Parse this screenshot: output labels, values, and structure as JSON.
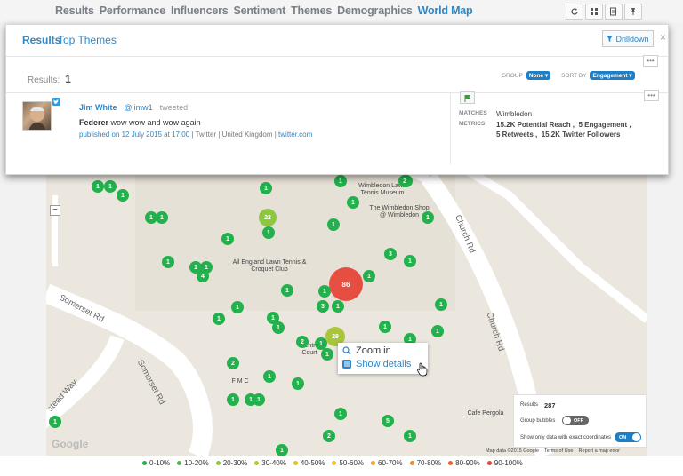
{
  "nav": {
    "tabs": [
      "Results",
      "Performance",
      "Influencers",
      "Sentiment",
      "Themes",
      "Demographics",
      "World Map"
    ],
    "active_tab": "World Map",
    "tools": [
      "refresh-icon",
      "grid-icon",
      "export-icon",
      "pin-icon"
    ]
  },
  "panel": {
    "title": "Results",
    "secondary_title": "Top Themes",
    "drilldown_label": "Drilldown",
    "close_label": "×",
    "results_label": "Results:",
    "results_count": "1",
    "group_label": "GROUP",
    "group_value": "None",
    "sort_label": "SORT BY",
    "sort_value": "Engagement",
    "tweet": {
      "author": "Jim White",
      "handle": "@jimw1",
      "verb": "tweeted",
      "keyword": "Federer",
      "text": " wow wow and wow again",
      "published_prefix": "published on 12 July 2015 at 17:00",
      "sep1": " | ",
      "platform": "Twitter",
      "sep2": " | ",
      "location": "United Kingdom",
      "sep3": " | ",
      "link": "twitter.com"
    },
    "meta": {
      "matches_label": "MATCHES",
      "matches_value": "Wimbledon",
      "metrics_label": "METRICS",
      "metrics_line1": "15.2K Potential Reach ,  5 Engagement ,",
      "metrics_line2": "5 Retweets ,  15.2K Twitter Followers"
    }
  },
  "map": {
    "labels": {
      "museum": "Wimbledon Lawn Tennis Museum",
      "shop": "The Wimbledon Shop @ Wimbledon",
      "club": "All England Lawn Tennis & Croquet Club",
      "centre": "Centre Court",
      "fmc": "F M C",
      "pergola": "Cafe Pergola",
      "somerset1": "Somerset Rd",
      "somerset2": "Somerset Rd",
      "church1": "Church Rd",
      "church2": "Church Rd",
      "way": "stead Way",
      "google": "Google",
      "attribution": "Map data ©2015 Google    Terms of Use    Report a map error"
    },
    "zoom_out": "−",
    "context_menu": {
      "zoom_in": "Zoom in",
      "show_details": "Show details"
    },
    "controls": {
      "results_label": "Results",
      "results_value": "287",
      "group_bubbles_label": "Group bubbles",
      "group_bubbles_state": "OFF",
      "exact_label": "Show only data with exact coordinates",
      "exact_state": "ON"
    },
    "clusters": [
      {
        "n": "1",
        "color": "#22b14c"
      },
      {
        "n": "1",
        "color": "#22b14c"
      },
      {
        "n": "1",
        "color": "#22b14c"
      },
      {
        "n": "1",
        "color": "#22b14c"
      },
      {
        "n": "1",
        "color": "#22b14c"
      },
      {
        "n": "1",
        "color": "#22b14c"
      },
      {
        "n": "22",
        "color": "#8dc63f"
      },
      {
        "n": "1",
        "color": "#22b14c"
      },
      {
        "n": "1",
        "color": "#22b14c"
      },
      {
        "n": "1",
        "color": "#22b14c"
      },
      {
        "n": "1",
        "color": "#22b14c"
      },
      {
        "n": "2",
        "color": "#22b14c"
      },
      {
        "n": "1",
        "color": "#22b14c"
      },
      {
        "n": "1",
        "color": "#22b14c"
      },
      {
        "n": "1",
        "color": "#22b14c"
      },
      {
        "n": "1",
        "color": "#22b14c"
      },
      {
        "n": "1",
        "color": "#22b14c"
      },
      {
        "n": "4",
        "color": "#22b14c"
      },
      {
        "n": "1",
        "color": "#22b14c"
      },
      {
        "n": "3",
        "color": "#22b14c"
      },
      {
        "n": "1",
        "color": "#22b14c"
      },
      {
        "n": "86",
        "color": "#e8473b"
      },
      {
        "n": "1",
        "color": "#22b14c"
      },
      {
        "n": "1",
        "color": "#22b14c"
      },
      {
        "n": "3",
        "color": "#22b14c"
      },
      {
        "n": "1",
        "color": "#22b14c"
      },
      {
        "n": "1",
        "color": "#22b14c"
      },
      {
        "n": "1",
        "color": "#22b14c"
      },
      {
        "n": "1",
        "color": "#22b14c"
      },
      {
        "n": "1",
        "color": "#22b14c"
      },
      {
        "n": "1",
        "color": "#22b14c"
      },
      {
        "n": "1",
        "color": "#22b14c"
      },
      {
        "n": "2",
        "color": "#22b14c"
      },
      {
        "n": "29",
        "color": "#a8c63a"
      },
      {
        "n": "1",
        "color": "#22b14c"
      },
      {
        "n": "1",
        "color": "#22b14c"
      },
      {
        "n": "2",
        "color": "#22b14c"
      },
      {
        "n": "1",
        "color": "#22b14c"
      },
      {
        "n": "1",
        "color": "#22b14c"
      },
      {
        "n": "1",
        "color": "#22b14c"
      },
      {
        "n": "1",
        "color": "#22b14c"
      },
      {
        "n": "1",
        "color": "#22b14c"
      },
      {
        "n": "1",
        "color": "#22b14c"
      },
      {
        "n": "1",
        "color": "#22b14c"
      },
      {
        "n": "1",
        "color": "#22b14c"
      },
      {
        "n": "5",
        "color": "#22b14c"
      },
      {
        "n": "1",
        "color": "#22b14c"
      },
      {
        "n": "2",
        "color": "#22b14c"
      },
      {
        "n": "1",
        "color": "#22b14c"
      },
      {
        "n": "1",
        "color": "#22b14c"
      },
      {
        "n": "1",
        "color": "#22b14c"
      }
    ]
  },
  "legend": [
    {
      "label": "0-10%",
      "color": "#22b14c"
    },
    {
      "label": "10-20%",
      "color": "#4db848"
    },
    {
      "label": "20-30%",
      "color": "#8dc63f"
    },
    {
      "label": "30-40%",
      "color": "#b5cc2e"
    },
    {
      "label": "40-50%",
      "color": "#d4c81f"
    },
    {
      "label": "50-60%",
      "color": "#f0c419"
    },
    {
      "label": "60-70%",
      "color": "#f5a623"
    },
    {
      "label": "70-80%",
      "color": "#f08a24"
    },
    {
      "label": "80-90%",
      "color": "#e8602c"
    },
    {
      "label": "90-100%",
      "color": "#e8473b"
    }
  ]
}
